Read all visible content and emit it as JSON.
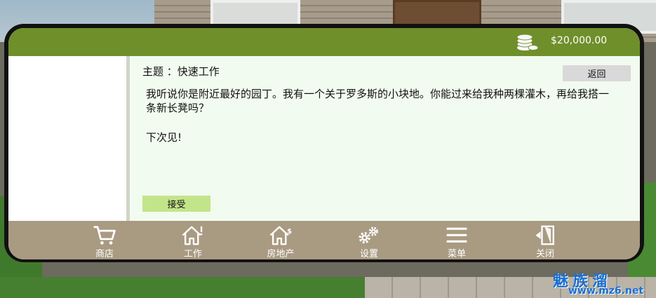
{
  "header": {
    "balance": "$20,000.00",
    "balance_icon": "coins-icon"
  },
  "mail": {
    "subject": "主题 ：快速工作",
    "message": "我听说你是附近最好的园丁。我有一个关于罗多斯的小块地。你能过来给我种两棵灌木，再给我搭一条新长凳吗？",
    "farewell": "下次见!",
    "back_label": "返回",
    "accept_label": "接受"
  },
  "nav": [
    {
      "label": "商店",
      "icon": "cart-icon"
    },
    {
      "label": "工作",
      "icon": "house-alert-icon"
    },
    {
      "label": "房地产",
      "icon": "house-dollar-icon"
    },
    {
      "label": "设置",
      "icon": "gears-icon"
    },
    {
      "label": "菜单",
      "icon": "hamburger-icon"
    },
    {
      "label": "关闭",
      "icon": "exit-door-icon"
    }
  ],
  "watermark": {
    "text": "魅族溜",
    "url": "www.mz6.net"
  },
  "colors": {
    "topbar": "#6f8f2b",
    "bottombar": "#a99a82",
    "accept": "#c3e58a",
    "back": "#d9d9d9"
  }
}
